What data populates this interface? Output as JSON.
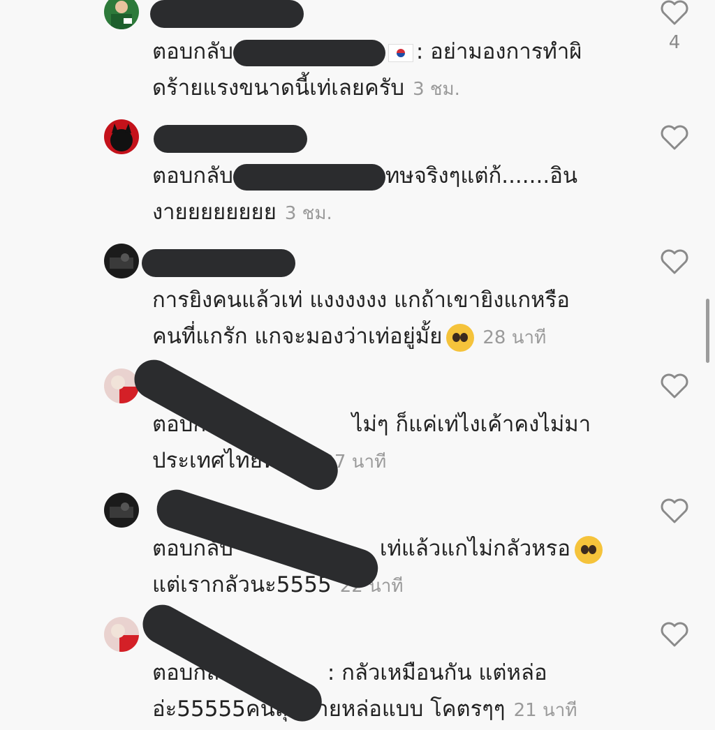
{
  "comments": [
    {
      "reply_prefix": "ตอบกลับ",
      "line1_after": ": อย่ามองการทำผิ",
      "line2": "ดร้ายแรงขนาดนี้เท่เลยครับ",
      "time": "3 ชม.",
      "likes": "4",
      "avatar_color": "#2d7a3a"
    },
    {
      "reply_prefix": "ตอบกลับ",
      "line1_after": "ทษจริงๆแต่ก้.......อิน",
      "line2": "งายยยยยยยย",
      "time": "3 ชม.",
      "avatar_color": "#c4121b"
    },
    {
      "line1": "การยิงคนแล้วเท่ แงงงงงง แกถ้าเขายิงแกหรือ",
      "line2": "คนที่แกรัก แกจะมองว่าเท่อยู่มั้ย",
      "time": "28 นาที",
      "avatar_color": "#1b1b1b"
    },
    {
      "reply_prefix": "ตอบกลับ",
      "line1_after": "ไม่ๆ ก็แค่เท่ไงเค้าคงไม่มา",
      "line2": "ประเทศไทยหรอก",
      "time": "27 นาที",
      "avatar_color": "#e9d2cf"
    },
    {
      "reply_prefix": "ตอบกลับ",
      "line1_after": "เท่แล้วแกไม่กลัวหรอ",
      "line2": "แต่เรากลัวนะ5555",
      "time": "22 นาที",
      "avatar_color": "#1b1b1b"
    },
    {
      "reply_prefix": "ตอบกลับ",
      "line1_after": ": กลัวเหมือนกัน แต่หล่อ",
      "line2": "อ่ะ55555คนสุดท้ายหล่อแบบ โคตรๆๆ",
      "time": "21 นาที",
      "avatar_color": "#e9d2cf"
    }
  ]
}
